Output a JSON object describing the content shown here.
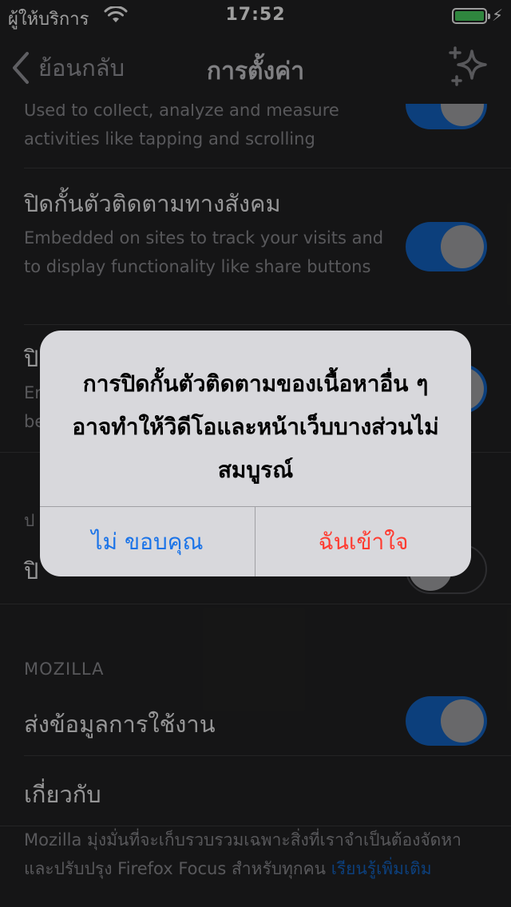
{
  "status_bar": {
    "carrier": "ผู้ให้บริการ",
    "time": "17:52",
    "battery_level": 1.0
  },
  "nav": {
    "back_label": "ย้อนกลับ",
    "title": "การตั้งค่า"
  },
  "settings": {
    "analytics_desc": "Used to collect, analyze and measure activities like tapping and scrolling",
    "social_title": "ปิดกั้นตัวติดตามทางสังคม",
    "social_desc": "Embedded on sites to track your visits and to display functionality like share buttons",
    "other_title": "ปิ",
    "other_desc_1": "En",
    "other_desc_2": "be",
    "section_partial": "ป",
    "row_partial_title": "ปิ",
    "mozilla_header": "MOZILLA",
    "send_usage_title": "ส่งข้อมูลการใช้งาน",
    "about_title": "เกี่ยวกับ",
    "footer_text": "Mozilla มุ่งมั่นที่จะเก็บรวบรวมเฉพาะสิ่งที่เราจำเป็นต้องจัดหาและปรับปรุง Firefox Focus สำหรับทุกคน ",
    "footer_link": "เรียนรู้เพิ่มเติม"
  },
  "toggles": {
    "analytics": true,
    "social": true,
    "other": true,
    "partial": false,
    "send_usage": true
  },
  "alert": {
    "message": "การปิดกั้นตัวติดตามของเนื้อหาอื่น ๆ อาจทำให้วิดีโอและหน้าเว็บบางส่วนไม่สมบูรณ์",
    "cancel_label": "ไม่ ขอบคุณ",
    "confirm_label": "ฉันเข้าใจ"
  },
  "colors": {
    "background": "#232324",
    "toggle_on": "#1467c8",
    "alert_cancel": "#1a73e8",
    "alert_confirm": "#ff3b30",
    "battery": "#4cd964"
  },
  "icons": [
    "back-chevron-icon",
    "wifi-icon",
    "battery-icon",
    "bolt-icon",
    "sparkle-icon"
  ]
}
